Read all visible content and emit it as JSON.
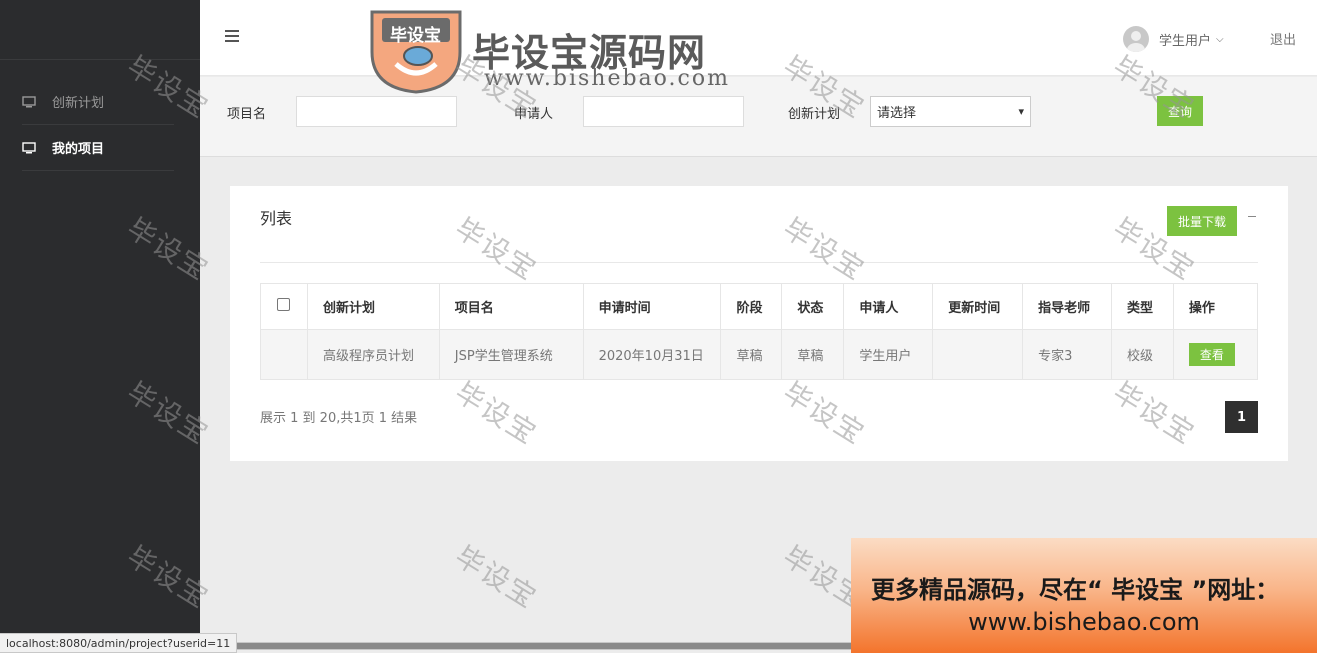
{
  "sidebar": {
    "items": [
      {
        "label": "创新计划",
        "icon": "monitor-icon",
        "active": false
      },
      {
        "label": "我的项目",
        "icon": "monitor-icon",
        "active": true
      }
    ]
  },
  "header": {
    "logo_text": "毕设宝",
    "brand_title": "毕设宝源码网",
    "brand_url": "www.bishebao.com",
    "user_name": "学生用户",
    "logout_label": "退出"
  },
  "filters": {
    "project_name_label": "项目名",
    "project_name_value": "",
    "applicant_label": "申请人",
    "applicant_value": "",
    "plan_label": "创新计划",
    "plan_selected": "请选择",
    "search_label": "查询"
  },
  "list": {
    "title": "列表",
    "batch_download_label": "批量下载",
    "columns": [
      "创新计划",
      "项目名",
      "申请时间",
      "阶段",
      "状态",
      "申请人",
      "更新时间",
      "指导老师",
      "类型",
      "操作"
    ],
    "rows": [
      {
        "plan": "高级程序员计划",
        "project": "JSP学生管理系统",
        "apply_time": "2020年10月31日",
        "stage": "草稿",
        "status": "草稿",
        "applicant": "学生用户",
        "update_time": "",
        "teacher": "专家3",
        "type": "校级",
        "action_label": "查看"
      }
    ],
    "pagination_info": "展示 1 到 20,共1页 1 结果",
    "current_page": "1"
  },
  "status_url": "localhost:8080/admin/project?userid=11",
  "banner": {
    "line1": "更多精品源码，尽在“ 毕设宝 ”网址：",
    "line2": "www.bishebao.com"
  },
  "watermark": "毕设宝",
  "colors": {
    "sidebar_bg": "#2b2c2e",
    "accent_green": "#7cc240",
    "page_bg": "#ececec"
  }
}
